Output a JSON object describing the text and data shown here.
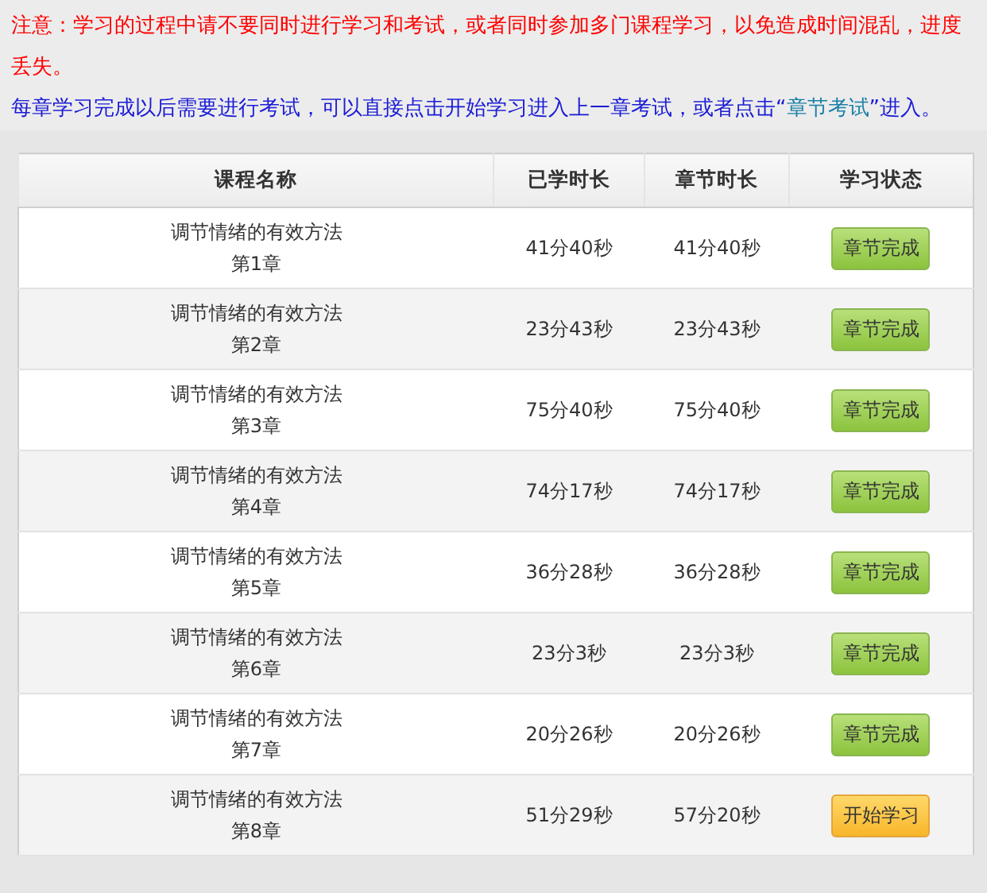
{
  "notices": [
    {
      "kind": "warning",
      "text": "注意：学习的过程中请不要同时进行学习和考试，或者同时参加多门课程学习，以免造成时间混乱，进度丢失。"
    },
    {
      "kind": "info",
      "before": "每章学习完成以后需要进行考试，可以直接点击开始学习进入上一章考试，或者点击“",
      "link": "章节考试",
      "after": "”进入。"
    }
  ],
  "table": {
    "columns": [
      "课程名称",
      "已学时长",
      "章节时长",
      "学习状态"
    ],
    "rows": [
      {
        "course": "调节情绪的有效方法",
        "chapter": "第1章",
        "studied": "41分40秒",
        "length": "41分40秒",
        "status": {
          "kind": "done",
          "label": "章节完成"
        }
      },
      {
        "course": "调节情绪的有效方法",
        "chapter": "第2章",
        "studied": "23分43秒",
        "length": "23分43秒",
        "status": {
          "kind": "done",
          "label": "章节完成"
        }
      },
      {
        "course": "调节情绪的有效方法",
        "chapter": "第3章",
        "studied": "75分40秒",
        "length": "75分40秒",
        "status": {
          "kind": "done",
          "label": "章节完成"
        }
      },
      {
        "course": "调节情绪的有效方法",
        "chapter": "第4章",
        "studied": "74分17秒",
        "length": "74分17秒",
        "status": {
          "kind": "done",
          "label": "章节完成"
        }
      },
      {
        "course": "调节情绪的有效方法",
        "chapter": "第5章",
        "studied": "36分28秒",
        "length": "36分28秒",
        "status": {
          "kind": "done",
          "label": "章节完成"
        }
      },
      {
        "course": "调节情绪的有效方法",
        "chapter": "第6章",
        "studied": "23分3秒",
        "length": "23分3秒",
        "status": {
          "kind": "done",
          "label": "章节完成"
        }
      },
      {
        "course": "调节情绪的有效方法",
        "chapter": "第7章",
        "studied": "20分26秒",
        "length": "20分26秒",
        "status": {
          "kind": "done",
          "label": "章节完成"
        }
      },
      {
        "course": "调节情绪的有效方法",
        "chapter": "第8章",
        "studied": "51分29秒",
        "length": "57分20秒",
        "status": {
          "kind": "start",
          "label": "开始学习"
        }
      }
    ]
  }
}
